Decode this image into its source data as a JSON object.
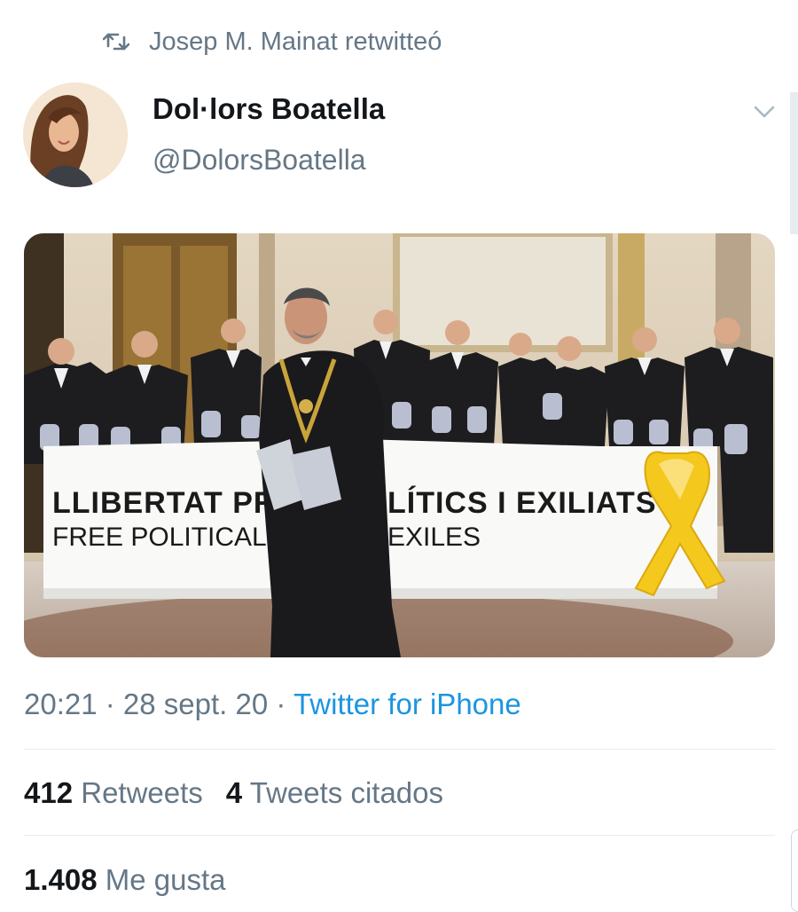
{
  "retweet": {
    "label": "Josep M. Mainat retwitteó",
    "icon": "retweet-icon"
  },
  "author": {
    "name": "Dol·lors Boatella",
    "handle": "@DolorsBoatella",
    "avatar_icon": "avatar"
  },
  "media": {
    "banner_line1_left": "LLIBERTAT PRE",
    "banner_line1_right": "LÍTICS I EXILIATS",
    "banner_line2_left": "FREE POLITICAL PRIS",
    "banner_line2_right": "EXILES"
  },
  "meta": {
    "time": "20:21",
    "separator": " · ",
    "date": "28 sept. 20",
    "source": "Twitter for iPhone"
  },
  "stats": {
    "retweets_count": "412",
    "retweets_label": "Retweets",
    "quotes_count": "4",
    "quotes_label": "Tweets citados",
    "likes_count": "1.408",
    "likes_label": "Me gusta"
  },
  "colors": {
    "link": "#1b95e0",
    "secondary": "#657786",
    "ribbon": "#f5c81e"
  }
}
